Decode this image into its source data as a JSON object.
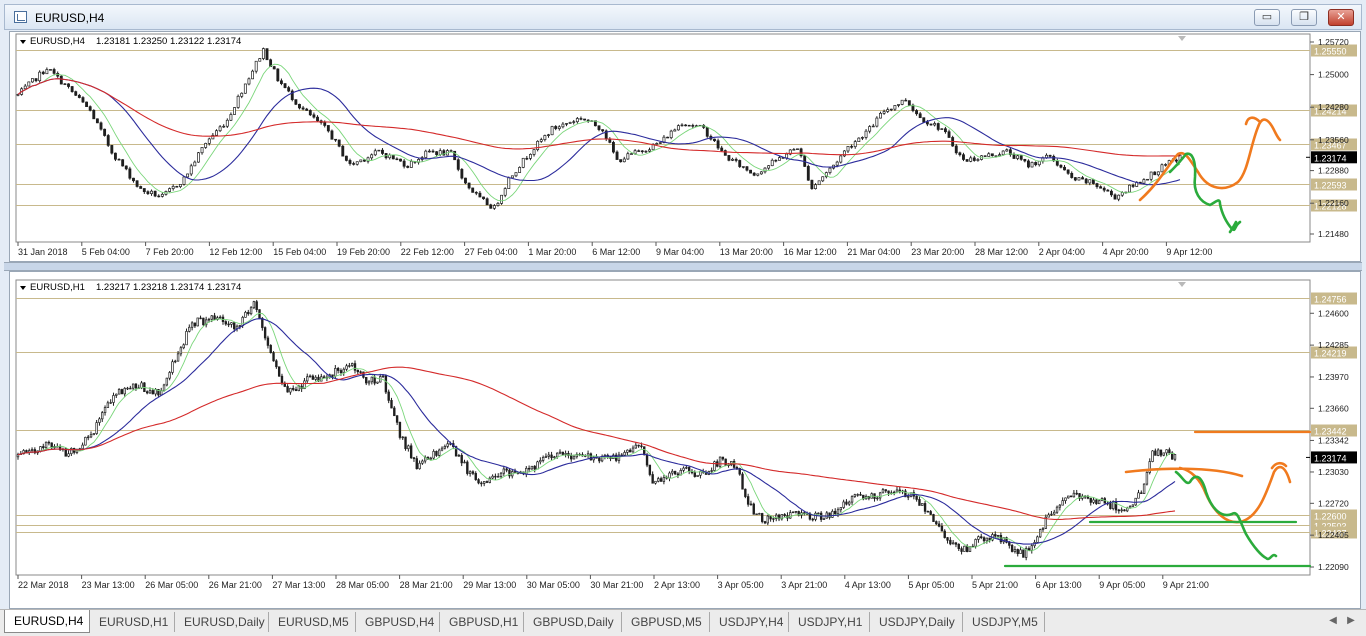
{
  "window": {
    "title": "EURUSD,H4",
    "minimize_glyph": "▭",
    "restore_glyph": "❐",
    "close_glyph": "✕"
  },
  "colors": {
    "up": "#1e1e1e",
    "down": "#1e1e1e",
    "ma_fast": "#7ad67a",
    "ma_mid": "#2c2c9c",
    "ma_slow": "#d42a2a",
    "level_line": "#c8b98c",
    "draw_orange": "#f07a1e",
    "draw_green": "#2bab3c"
  },
  "chart_data": [
    {
      "type": "candlestick",
      "title": "EURUSD,H4",
      "ohlc_label": "1.23181 1.23250 1.23122 1.23174",
      "ylim": [
        1.2148,
        1.2572
      ],
      "y_ticks": [
        "1.25720",
        "1.25000",
        "1.24280",
        "1.23560",
        "1.22880",
        "1.22160",
        "1.21480"
      ],
      "x_labels": [
        "31 Jan 2018",
        "5 Feb 04:00",
        "7 Feb 20:00",
        "12 Feb 12:00",
        "15 Feb 04:00",
        "19 Feb 20:00",
        "22 Feb 12:00",
        "27 Feb 04:00",
        "1 Mar 20:00",
        "6 Mar 12:00",
        "9 Mar 04:00",
        "13 Mar 20:00",
        "16 Mar 12:00",
        "21 Mar 04:00",
        "23 Mar 20:00",
        "28 Mar 12:00",
        "2 Apr 04:00",
        "4 Apr 20:00",
        "9 Apr 12:00"
      ],
      "levels": [
        {
          "label": "1.25550",
          "value": 1.2555
        },
        {
          "label": "1.24214",
          "value": 1.24214
        },
        {
          "label": "1.23467",
          "value": 1.23467
        },
        {
          "label": "1.22593",
          "value": 1.22593
        },
        {
          "label": "1.22128",
          "value": 1.22128
        }
      ],
      "current_price": "1.23174",
      "path": [
        [
          0,
          1.2455
        ],
        [
          8,
          1.2515
        ],
        [
          14,
          1.247
        ],
        [
          20,
          1.242
        ],
        [
          26,
          1.233
        ],
        [
          34,
          1.2245
        ],
        [
          40,
          1.223
        ],
        [
          46,
          1.227
        ],
        [
          52,
          1.235
        ],
        [
          58,
          1.24
        ],
        [
          62,
          1.2465
        ],
        [
          68,
          1.2555
        ],
        [
          72,
          1.249
        ],
        [
          78,
          1.243
        ],
        [
          86,
          1.2375
        ],
        [
          92,
          1.23
        ],
        [
          100,
          1.233
        ],
        [
          108,
          1.23
        ],
        [
          114,
          1.233
        ],
        [
          120,
          1.2325
        ],
        [
          124,
          1.226
        ],
        [
          128,
          1.2225
        ],
        [
          132,
          1.2205
        ],
        [
          136,
          1.227
        ],
        [
          142,
          1.233
        ],
        [
          148,
          1.238
        ],
        [
          156,
          1.2405
        ],
        [
          162,
          1.238
        ],
        [
          166,
          1.231
        ],
        [
          172,
          1.233
        ],
        [
          178,
          1.235
        ],
        [
          184,
          1.2395
        ],
        [
          190,
          1.238
        ],
        [
          196,
          1.232
        ],
        [
          204,
          1.228
        ],
        [
          210,
          1.231
        ],
        [
          216,
          1.234
        ],
        [
          220,
          1.225
        ],
        [
          226,
          1.23
        ],
        [
          230,
          1.234
        ],
        [
          236,
          1.238
        ],
        [
          240,
          1.242
        ],
        [
          246,
          1.2445
        ],
        [
          250,
          1.2405
        ],
        [
          256,
          1.238
        ],
        [
          262,
          1.231
        ],
        [
          268,
          1.232
        ],
        [
          274,
          1.233
        ],
        [
          280,
          1.23
        ],
        [
          286,
          1.232
        ],
        [
          292,
          1.227
        ],
        [
          298,
          1.226
        ],
        [
          304,
          1.223
        ],
        [
          310,
          1.226
        ],
        [
          316,
          1.229
        ],
        [
          322,
          1.2318
        ]
      ],
      "overlays": [
        {
          "name": "ma_fast",
          "period": 8
        },
        {
          "name": "ma_mid",
          "period": 24
        },
        {
          "name": "ma_slow",
          "period": 110
        }
      ],
      "candles": 323
    },
    {
      "type": "candlestick",
      "title": "EURUSD,H1",
      "ohlc_label": "1.23217 1.23218 1.23174 1.23174",
      "ylim": [
        1.2209,
        1.2485
      ],
      "y_ticks": [
        "1.24600",
        "1.24285",
        "1.23970",
        "1.23660",
        "1.23342",
        "1.23030",
        "1.22720",
        "1.22405",
        "1.22090"
      ],
      "x_labels": [
        "22 Mar 2018",
        "23 Mar 13:00",
        "26 Mar 05:00",
        "26 Mar 21:00",
        "27 Mar 13:00",
        "28 Mar 05:00",
        "28 Mar 21:00",
        "29 Mar 13:00",
        "30 Mar 05:00",
        "30 Mar 21:00",
        "2 Apr 13:00",
        "3 Apr 05:00",
        "3 Apr 21:00",
        "4 Apr 13:00",
        "5 Apr 05:00",
        "5 Apr 21:00",
        "6 Apr 13:00",
        "9 Apr 05:00",
        "9 Apr 21:00"
      ],
      "levels": [
        {
          "label": "1.24756",
          "value": 1.24756
        },
        {
          "label": "1.24219",
          "value": 1.24219
        },
        {
          "label": "1.23442",
          "value": 1.23442
        },
        {
          "label": "1.22503",
          "value": 1.22503
        },
        {
          "label": "1.22600",
          "value": 1.226
        },
        {
          "label": "1.22437",
          "value": 1.22437
        }
      ],
      "current_price": "1.23174",
      "path": [
        [
          0,
          1.2318
        ],
        [
          10,
          1.233
        ],
        [
          18,
          1.232
        ],
        [
          26,
          1.234
        ],
        [
          34,
          1.238
        ],
        [
          42,
          1.239
        ],
        [
          50,
          1.238
        ],
        [
          56,
          1.2415
        ],
        [
          62,
          1.245
        ],
        [
          70,
          1.2455
        ],
        [
          78,
          1.2445
        ],
        [
          84,
          1.247
        ],
        [
          90,
          1.242
        ],
        [
          96,
          1.238
        ],
        [
          104,
          1.2395
        ],
        [
          112,
          1.24
        ],
        [
          118,
          1.241
        ],
        [
          124,
          1.2395
        ],
        [
          130,
          1.2395
        ],
        [
          136,
          1.234
        ],
        [
          142,
          1.231
        ],
        [
          148,
          1.232
        ],
        [
          154,
          1.233
        ],
        [
          160,
          1.2305
        ],
        [
          166,
          1.229
        ],
        [
          172,
          1.2305
        ],
        [
          178,
          1.23
        ],
        [
          184,
          1.231
        ],
        [
          192,
          1.232
        ],
        [
          200,
          1.232
        ],
        [
          208,
          1.2315
        ],
        [
          216,
          1.232
        ],
        [
          222,
          1.233
        ],
        [
          226,
          1.2295
        ],
        [
          232,
          1.23
        ],
        [
          238,
          1.2305
        ],
        [
          244,
          1.23
        ],
        [
          250,
          1.2315
        ],
        [
          256,
          1.231
        ],
        [
          260,
          1.227
        ],
        [
          266,
          1.2255
        ],
        [
          274,
          1.226
        ],
        [
          282,
          1.226
        ],
        [
          288,
          1.226
        ],
        [
          294,
          1.227
        ],
        [
          300,
          1.228
        ],
        [
          306,
          1.228
        ],
        [
          312,
          1.2285
        ],
        [
          318,
          1.228
        ],
        [
          324,
          1.2265
        ],
        [
          330,
          1.224
        ],
        [
          336,
          1.2225
        ],
        [
          342,
          1.2235
        ],
        [
          348,
          1.224
        ],
        [
          354,
          1.2228
        ],
        [
          358,
          1.222
        ],
        [
          362,
          1.2235
        ],
        [
          366,
          1.2255
        ],
        [
          372,
          1.2275
        ],
        [
          378,
          1.228
        ],
        [
          384,
          1.2275
        ],
        [
          390,
          1.227
        ],
        [
          396,
          1.2265
        ],
        [
          400,
          1.2285
        ],
        [
          404,
          1.232
        ],
        [
          408,
          1.2322
        ],
        [
          412,
          1.2318
        ]
      ],
      "overlays": [
        {
          "name": "ma_fast",
          "period": 8
        },
        {
          "name": "ma_mid",
          "period": 24
        },
        {
          "name": "ma_slow",
          "period": 110
        }
      ],
      "candles": 413
    }
  ],
  "tabs": [
    {
      "label": "EURUSD,H4",
      "active": true
    },
    {
      "label": "EURUSD,H1"
    },
    {
      "label": "EURUSD,Daily"
    },
    {
      "label": "EURUSD,M5"
    },
    {
      "label": "GBPUSD,H4"
    },
    {
      "label": "GBPUSD,H1"
    },
    {
      "label": "GBPUSD,Daily"
    },
    {
      "label": "GBPUSD,M5"
    },
    {
      "label": "USDJPY,H4"
    },
    {
      "label": "USDJPY,H1"
    },
    {
      "label": "USDJPY,Daily"
    },
    {
      "label": "USDJPY,M5"
    }
  ],
  "tab_scroll": {
    "left": "◀",
    "right": "▶"
  }
}
